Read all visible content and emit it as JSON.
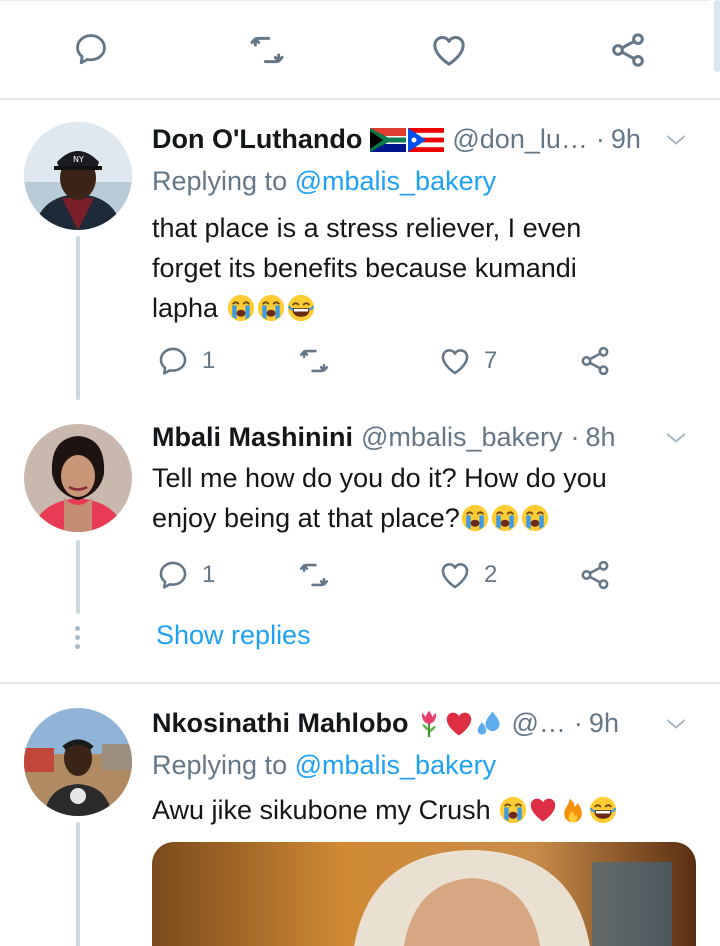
{
  "colors": {
    "accent": "#1da1f2",
    "secondary_text": "#657786",
    "primary_text": "#14171a",
    "divider": "#e1e8ed"
  },
  "top_actions": {
    "reply_icon": "comment-icon",
    "retweet_icon": "retweet-icon",
    "like_icon": "heart-icon",
    "share_icon": "share-icon"
  },
  "tweets": [
    {
      "display_name": "Don O'Luthando",
      "flags": [
        "south-africa-flag",
        "puerto-rico-flag"
      ],
      "handle": "@don_lu…",
      "separator": "·",
      "time": "9h",
      "replying_prefix": "Replying to",
      "replying_to": "@mbalis_bakery",
      "text_line1": "that place is a stress reliever, I even",
      "text_line2": "forget its benefits because kumandi",
      "text_line3": "lapha",
      "emojis": [
        "crying-face",
        "crying-face",
        "laughing-face"
      ],
      "reply_count": "1",
      "like_count": "7"
    },
    {
      "display_name": "Mbali Mashinini",
      "handle": "@mbalis_bakery",
      "separator": "·",
      "time": "8h",
      "text_line1": "Tell me how do you do it? How do you",
      "text_line2": "enjoy being at that place?",
      "emojis": [
        "crying-face",
        "crying-face",
        "crying-face"
      ],
      "reply_count": "1",
      "like_count": "2",
      "show_replies": "Show replies"
    },
    {
      "display_name": "Nkosinathi Mahlobo",
      "name_emojis": [
        "tulip",
        "red-heart",
        "sweat-droplets"
      ],
      "handle": "@…",
      "separator": "·",
      "time": "9h",
      "replying_prefix": "Replying to",
      "replying_to": "@mbalis_bakery",
      "text": "Awu jike sikubone my Crush",
      "emojis": [
        "crying-face",
        "red-heart",
        "fire",
        "laughing-face"
      ]
    }
  ]
}
